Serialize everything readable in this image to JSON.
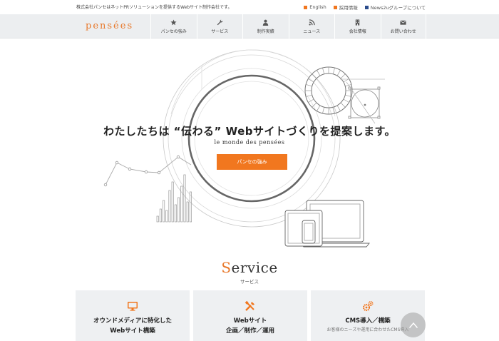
{
  "topbar": {
    "tagline": "株式会社パンセはネットPRソリューションを提供するWebサイト制作会社です。",
    "links": [
      {
        "label": "English",
        "color": "#f1771f"
      },
      {
        "label": "採用情報",
        "color": "#f1771f"
      },
      {
        "label": "News2uグループについて",
        "color": "#2b4c8c"
      }
    ]
  },
  "nav": {
    "logo": "pensées",
    "items": [
      {
        "label": "パンセの強み",
        "icon": "star-icon"
      },
      {
        "label": "サービス",
        "icon": "wrench-icon"
      },
      {
        "label": "制作実績",
        "icon": "person-icon"
      },
      {
        "label": "ニュース",
        "icon": "rss-icon"
      },
      {
        "label": "会社情報",
        "icon": "building-icon"
      },
      {
        "label": "お問い合わせ",
        "icon": "envelope-icon"
      }
    ]
  },
  "hero": {
    "headline": "わたしたちは “伝わる” Webサイトづくりを提案します。",
    "subline": "le monde des pensées",
    "cta_label": "パンセの強み"
  },
  "service": {
    "title_first": "S",
    "title_rest": "ervice",
    "subtitle": "サービス",
    "cards": [
      {
        "icon": "monitor-icon",
        "line1": "オウンドメディアに特化した",
        "line2": "Webサイト構築",
        "desc": ""
      },
      {
        "icon": "tools-icon",
        "line1": "Webサイト",
        "line2": "企画／制作／運用",
        "desc": ""
      },
      {
        "icon": "gears-icon",
        "line1": "CMS導入／構築",
        "line2": "",
        "desc": "お客様のニーズや運用に合わせたCMS導入"
      }
    ]
  },
  "colors": {
    "accent": "#f1771f",
    "nav_bg": "#eceef0",
    "card_bg": "#eef0f2"
  }
}
